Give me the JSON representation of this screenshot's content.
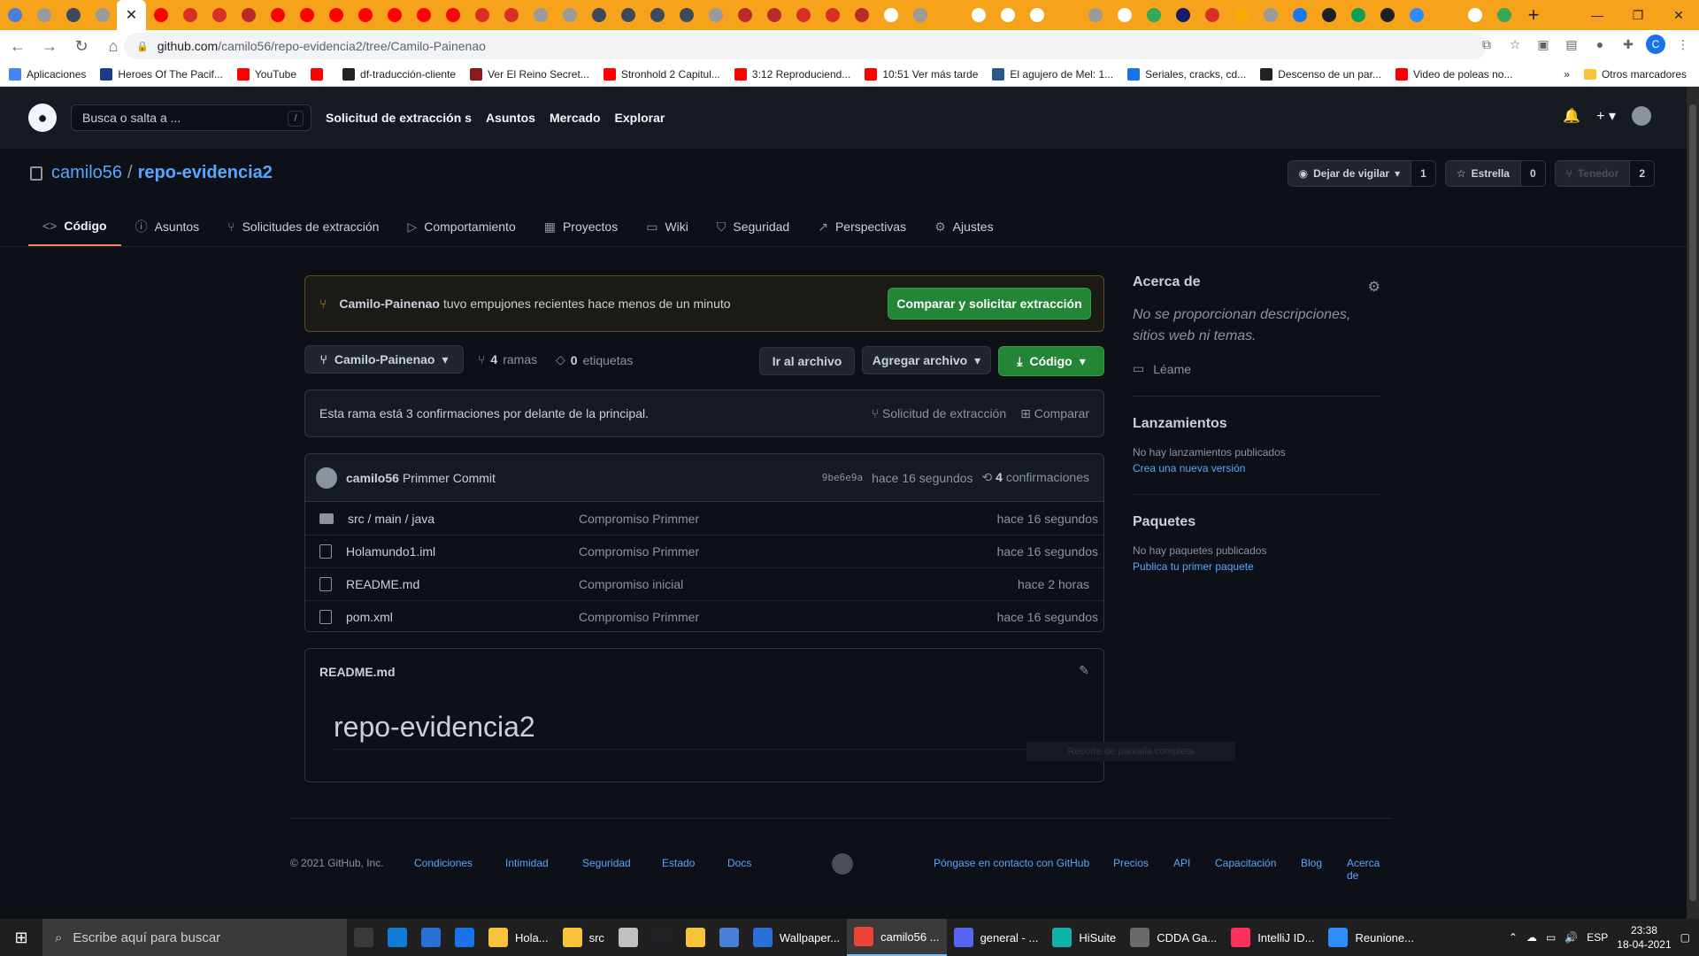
{
  "browser": {
    "tab_favicons": [
      {
        "name": "globe",
        "color": "#4a7fd8"
      },
      {
        "name": "chrome",
        "color": "#9a9a9a"
      },
      {
        "name": "settings",
        "color": "#3c4a5c"
      },
      {
        "name": "chrome",
        "color": "#9a9a9a"
      },
      {
        "name": "close",
        "color": "#202124",
        "active": true
      },
      {
        "name": "youtube",
        "color": "#ff0000"
      },
      {
        "name": "gmail",
        "color": "#d93025"
      },
      {
        "name": "gmail",
        "color": "#d93025"
      },
      {
        "name": "quora",
        "color": "#b92b27"
      },
      {
        "name": "youtube",
        "color": "#ff0000"
      },
      {
        "name": "youtube",
        "color": "#ff0000"
      },
      {
        "name": "youtube",
        "color": "#ff0000"
      },
      {
        "name": "youtube",
        "color": "#ff0000"
      },
      {
        "name": "youtube",
        "color": "#ff0000"
      },
      {
        "name": "youtube",
        "color": "#ff0000"
      },
      {
        "name": "youtube",
        "color": "#ff0000"
      },
      {
        "name": "gmail",
        "color": "#d93025"
      },
      {
        "name": "gmail",
        "color": "#d93025"
      },
      {
        "name": "chrome",
        "color": "#9a9a9a"
      },
      {
        "name": "chrome",
        "color": "#9a9a9a"
      },
      {
        "name": "settings",
        "color": "#3c4a5c"
      },
      {
        "name": "settings",
        "color": "#3c4a5c"
      },
      {
        "name": "settings",
        "color": "#3c4a5c"
      },
      {
        "name": "settings",
        "color": "#3c4a5c"
      },
      {
        "name": "chrome",
        "color": "#9a9a9a"
      },
      {
        "name": "quora",
        "color": "#b92b27"
      },
      {
        "name": "quora",
        "color": "#b92b27"
      },
      {
        "name": "gmail",
        "color": "#d93025"
      },
      {
        "name": "gmail",
        "color": "#d93025"
      },
      {
        "name": "quora",
        "color": "#b92b27"
      },
      {
        "name": "google",
        "color": "#ffffff"
      },
      {
        "name": "chrome",
        "color": "#9a9a9a"
      },
      {
        "name": "blank",
        "color": "#f6a21a"
      },
      {
        "name": "google",
        "color": "#ffffff"
      },
      {
        "name": "google",
        "color": "#ffffff"
      },
      {
        "name": "google",
        "color": "#ffffff"
      },
      {
        "name": "nu",
        "color": "#f6a21a"
      },
      {
        "name": "chrome",
        "color": "#9a9a9a"
      },
      {
        "name": "google",
        "color": "#ffffff"
      },
      {
        "name": "leaf",
        "color": "#34a853"
      },
      {
        "name": "a-letter",
        "color": "#1a1a6a"
      },
      {
        "name": "emoji",
        "color": "#d93025"
      },
      {
        "name": "orange",
        "color": "#f9ab00"
      },
      {
        "name": "chrome",
        "color": "#9a9a9a"
      },
      {
        "name": "facebook",
        "color": "#1877f2"
      },
      {
        "name": "heart",
        "color": "#202124"
      },
      {
        "name": "green-1",
        "color": "#0f9d58"
      },
      {
        "name": "github",
        "color": "#202124"
      },
      {
        "name": "zoom",
        "color": "#2d8cff"
      },
      {
        "name": "nu",
        "color": "#f6a21a"
      },
      {
        "name": "google",
        "color": "#ffffff"
      },
      {
        "name": "drive",
        "color": "#34a853"
      }
    ],
    "url_host": "github.com",
    "url_path": "/camilo56/repo-evidencia2/tree/Camilo-Painenao",
    "profile_initial": "C",
    "bookmarks": [
      {
        "label": "Aplicaciones",
        "color": "#4285f4"
      },
      {
        "label": "Heroes Of The Pacif...",
        "color": "#1a3a8a"
      },
      {
        "label": "YouTube",
        "color": "#ff0000"
      },
      {
        "label": "",
        "color": "#ff0000"
      },
      {
        "label": "df-traducción-cliente",
        "color": "#202124"
      },
      {
        "label": "Ver El Reino Secret...",
        "color": "#8b1a1a"
      },
      {
        "label": "Stronhold 2 Capitul...",
        "color": "#ff0000"
      },
      {
        "label": "3:12 Reproduciend...",
        "color": "#ff0000"
      },
      {
        "label": "10:51 Ver más tarde",
        "color": "#ff0000"
      },
      {
        "label": "El agujero de Mel: 1...",
        "color": "#2a5a8a"
      },
      {
        "label": "Seriales, cracks, cd...",
        "color": "#1a73e8"
      },
      {
        "label": "Descenso de un par...",
        "color": "#202124"
      },
      {
        "label": "Video de poleas no...",
        "color": "#ff0000"
      }
    ],
    "bookmarks_more": "»",
    "bookmarks_other": "Otros marcadores"
  },
  "github_header": {
    "search_placeholder": "Busca o salta a ...",
    "search_key": "/",
    "nav": [
      "Solicitud de extracción s",
      "Asuntos",
      "Mercado",
      "Explorar"
    ]
  },
  "repo": {
    "owner": "camilo56",
    "name": "repo-evidencia2",
    "watch_label": "Dejar de vigilar",
    "watch_count": "1",
    "star_label": "Estrella",
    "star_count": "0",
    "fork_label": "Tenedor",
    "fork_count": "2"
  },
  "tabs": [
    {
      "label": "Código",
      "icon": "<>",
      "active": true
    },
    {
      "label": "Asuntos",
      "icon": "ⓘ"
    },
    {
      "label": "Solicitudes de extracción",
      "icon": "⑂"
    },
    {
      "label": "Comportamiento",
      "icon": "▷"
    },
    {
      "label": "Proyectos",
      "icon": "▦"
    },
    {
      "label": "Wiki",
      "icon": "▭"
    },
    {
      "label": "Seguridad",
      "icon": "⛉"
    },
    {
      "label": "Perspectivas",
      "icon": "↗"
    },
    {
      "label": "Ajustes",
      "icon": "⚙"
    }
  ],
  "push_banner": {
    "branch": "Camilo-Painenao",
    "message": "tuvo empujones recientes hace menos de un minuto",
    "button": "Comparar y solicitar extracción"
  },
  "branch_bar": {
    "branch": "Camilo-Painenao",
    "branches_count": "4",
    "branches_label": "ramas",
    "tags_count": "0",
    "tags_label": "etiquetas",
    "goto_file": "Ir al archivo",
    "add_file": "Agregar archivo",
    "code": "Código"
  },
  "ahead": {
    "text": "Esta rama está 3 confirmaciones por delante de la principal.",
    "pull_request": "Solicitud de extracción",
    "compare": "Comparar"
  },
  "commit": {
    "author": "camilo56",
    "message": "Primmer Commit",
    "sha": "9be6e9a",
    "time": "hace 16 segundos",
    "count": "4",
    "count_label": "confirmaciones"
  },
  "files": [
    {
      "name": "src / main / java",
      "type": "dir",
      "message": "Compromiso Primmer",
      "time": "hace 16 segundos"
    },
    {
      "name": "Holamundo1.iml",
      "type": "file",
      "message": "Compromiso Primmer",
      "time": "hace 16 segundos"
    },
    {
      "name": "README.md",
      "type": "file",
      "message": "Compromiso inicial",
      "time": "hace 2 horas"
    },
    {
      "name": "pom.xml",
      "type": "file",
      "message": "Compromiso Primmer",
      "time": "hace 16 segundos"
    }
  ],
  "readme": {
    "filename": "README.md",
    "heading": "repo-evidencia2",
    "overlay_tip": "Recorte de pantalla completa"
  },
  "sidebar": {
    "about_title": "Acerca de",
    "about_text": "No se proporcionan descripciones, sitios web ni temas.",
    "readme_link": "Léame",
    "releases_title": "Lanzamientos",
    "releases_none": "No hay lanzamientos publicados",
    "releases_link": "Crea una nueva versión",
    "packages_title": "Paquetes",
    "packages_none": "No hay paquetes publicados",
    "packages_link": "Publica tu primer paquete"
  },
  "footer": {
    "copyright": "© 2021 GitHub, Inc.",
    "links_left": [
      "Condiciones",
      "Intimidad",
      "Seguridad",
      "Estado",
      "Docs"
    ],
    "links_right": [
      "Póngase en contacto con GitHub",
      "Precios",
      "API",
      "Capacitación",
      "Blog",
      "Acerca de"
    ]
  },
  "taskbar": {
    "search_placeholder": "Escribe aquí para buscar",
    "apps": [
      {
        "label": "",
        "color": "#3a3a3a",
        "icon": "task-view"
      },
      {
        "label": "",
        "color": "#0f7dd8",
        "icon": "edge"
      },
      {
        "label": "",
        "color": "#2a6fd6",
        "icon": "shield"
      },
      {
        "label": "",
        "color": "#1a73e8",
        "icon": "mail"
      },
      {
        "label": "Hola...",
        "color": "#f6c33a",
        "icon": "folder"
      },
      {
        "label": "src",
        "color": "#f6c33a",
        "icon": "folder"
      },
      {
        "label": "",
        "color": "#c0c0c0",
        "icon": "gpu"
      },
      {
        "label": "",
        "color": "#202124",
        "icon": "terminal"
      },
      {
        "label": "",
        "color": "#f6c33a",
        "icon": "sticky"
      },
      {
        "label": "",
        "color": "#4a7fd8",
        "icon": "tool"
      },
      {
        "label": "Wallpaper...",
        "color": "#2a6fd6",
        "icon": "wallpaper"
      },
      {
        "label": "camilo56 ...",
        "color": "#ea4335",
        "icon": "chrome",
        "active": true
      },
      {
        "label": "general - ...",
        "color": "#5865f2",
        "icon": "discord"
      },
      {
        "label": "HiSuite",
        "color": "#0fb3a8",
        "icon": "hisuite"
      },
      {
        "label": "CDDA Ga...",
        "color": "#6a6a6a",
        "icon": "game"
      },
      {
        "label": "IntelliJ ID...",
        "color": "#fe315d",
        "icon": "intellij"
      },
      {
        "label": "Reunione...",
        "color": "#2d8cff",
        "icon": "zoom"
      }
    ],
    "lang": "ESP",
    "time": "23:38",
    "date": "18-04-2021"
  }
}
